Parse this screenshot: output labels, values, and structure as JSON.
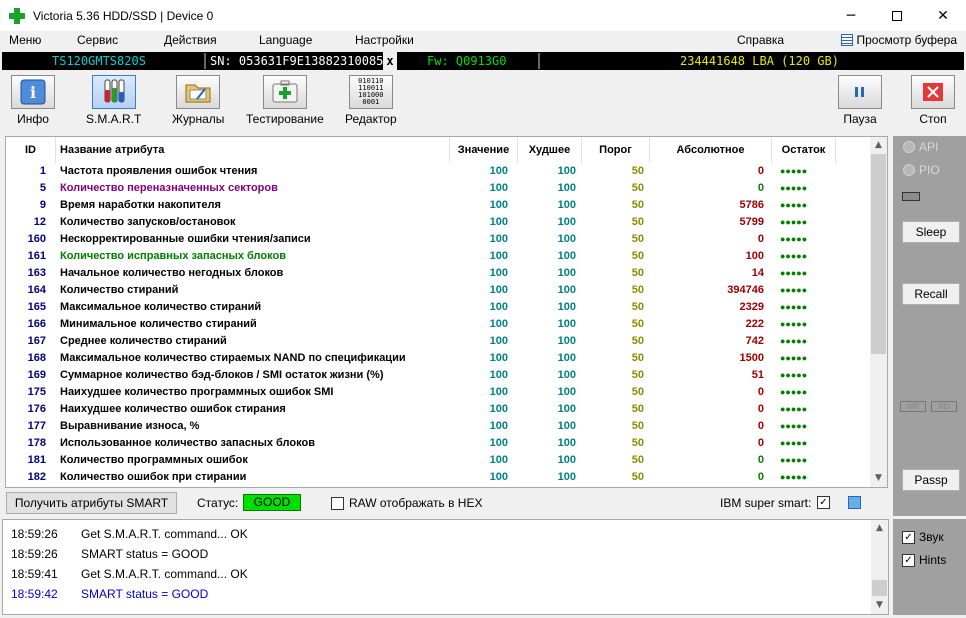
{
  "window": {
    "title": "Victoria 5.36 HDD/SSD | Device 0"
  },
  "menu": {
    "items": [
      "Меню",
      "Сервис",
      "Действия",
      "Language",
      "Настройки"
    ],
    "help": "Справка",
    "buffer": "Просмотр буфера"
  },
  "infobar": {
    "model": "TS120GMTS820S",
    "serial": "SN: 053631F9E13882310085",
    "close": "x",
    "firmware": "Fw: Q0913G0",
    "capacity": "234441648 LBA (120 GB)"
  },
  "toolbar": {
    "info": "Инфо",
    "smart": "S.M.A.R.T",
    "logs": "Журналы",
    "testing": "Тестирование",
    "editor": "Редактор",
    "pause": "Пауза",
    "stop": "Стоп",
    "editor_hex": [
      "010110",
      "110011",
      "101000",
      "0001"
    ]
  },
  "table": {
    "headers": {
      "id": "ID",
      "name": "Название атрибута",
      "value": "Значение",
      "worst": "Худшее",
      "threshold": "Порог",
      "raw": "Абсолютное",
      "remaining": "Остаток"
    },
    "rows": [
      {
        "id": "1",
        "name": "Частота проявления ошибок чтения",
        "value": "100",
        "worst": "100",
        "threshold": "50",
        "raw": "0",
        "remaining": "●●●●●",
        "name_color": "#000000",
        "raw_color": "#a00000"
      },
      {
        "id": "5",
        "name": "Количество переназначенных секторов",
        "value": "100",
        "worst": "100",
        "threshold": "50",
        "raw": "0",
        "remaining": "●●●●●",
        "name_color": "#800080",
        "raw_color": "#008000"
      },
      {
        "id": "9",
        "name": "Время наработки накопителя",
        "value": "100",
        "worst": "100",
        "threshold": "50",
        "raw": "5786",
        "remaining": "●●●●●",
        "name_color": "#000000",
        "raw_color": "#a00000"
      },
      {
        "id": "12",
        "name": "Количество запусков/остановок",
        "value": "100",
        "worst": "100",
        "threshold": "50",
        "raw": "5799",
        "remaining": "●●●●●",
        "name_color": "#000000",
        "raw_color": "#a00000"
      },
      {
        "id": "160",
        "name": "Нескорректированные ошибки чтения/записи",
        "value": "100",
        "worst": "100",
        "threshold": "50",
        "raw": "0",
        "remaining": "●●●●●",
        "name_color": "#000000",
        "raw_color": "#a00000"
      },
      {
        "id": "161",
        "name": "Количество исправных запасных блоков",
        "value": "100",
        "worst": "100",
        "threshold": "50",
        "raw": "100",
        "remaining": "●●●●●",
        "name_color": "#008000",
        "raw_color": "#a00000"
      },
      {
        "id": "163",
        "name": "Начальное количество негодных блоков",
        "value": "100",
        "worst": "100",
        "threshold": "50",
        "raw": "14",
        "remaining": "●●●●●",
        "name_color": "#000000",
        "raw_color": "#a00000"
      },
      {
        "id": "164",
        "name": "Количество стираний",
        "value": "100",
        "worst": "100",
        "threshold": "50",
        "raw": "394746",
        "remaining": "●●●●●",
        "name_color": "#000000",
        "raw_color": "#a00000"
      },
      {
        "id": "165",
        "name": "Максимальное количество стираний",
        "value": "100",
        "worst": "100",
        "threshold": "50",
        "raw": "2329",
        "remaining": "●●●●●",
        "name_color": "#000000",
        "raw_color": "#a00000"
      },
      {
        "id": "166",
        "name": "Минимальное количество стираний",
        "value": "100",
        "worst": "100",
        "threshold": "50",
        "raw": "222",
        "remaining": "●●●●●",
        "name_color": "#000000",
        "raw_color": "#a00000"
      },
      {
        "id": "167",
        "name": "Среднее количество стираний",
        "value": "100",
        "worst": "100",
        "threshold": "50",
        "raw": "742",
        "remaining": "●●●●●",
        "name_color": "#000000",
        "raw_color": "#a00000"
      },
      {
        "id": "168",
        "name": "Максимальное количество стираемых NAND по спецификации",
        "value": "100",
        "worst": "100",
        "threshold": "50",
        "raw": "1500",
        "remaining": "●●●●●",
        "name_color": "#000000",
        "raw_color": "#a00000"
      },
      {
        "id": "169",
        "name": "Суммарное количество бэд-блоков / SMI остаток жизни (%)",
        "value": "100",
        "worst": "100",
        "threshold": "50",
        "raw": "51",
        "remaining": "●●●●●",
        "name_color": "#000000",
        "raw_color": "#a00000"
      },
      {
        "id": "175",
        "name": "Наихудшее количество программных ошибок SMI",
        "value": "100",
        "worst": "100",
        "threshold": "50",
        "raw": "0",
        "remaining": "●●●●●",
        "name_color": "#000000",
        "raw_color": "#a00000"
      },
      {
        "id": "176",
        "name": "Наихудшее количество ошибок стирания",
        "value": "100",
        "worst": "100",
        "threshold": "50",
        "raw": "0",
        "remaining": "●●●●●",
        "name_color": "#000000",
        "raw_color": "#a00000"
      },
      {
        "id": "177",
        "name": "Выравнивание износа, %",
        "value": "100",
        "worst": "100",
        "threshold": "50",
        "raw": "0",
        "remaining": "●●●●●",
        "name_color": "#000000",
        "raw_color": "#a00000"
      },
      {
        "id": "178",
        "name": "Использованное количество запасных блоков",
        "value": "100",
        "worst": "100",
        "threshold": "50",
        "raw": "0",
        "remaining": "●●●●●",
        "name_color": "#000000",
        "raw_color": "#a00000"
      },
      {
        "id": "181",
        "name": "Количество программных ошибок",
        "value": "100",
        "worst": "100",
        "threshold": "50",
        "raw": "0",
        "remaining": "●●●●●",
        "name_color": "#000000",
        "raw_color": "#008000"
      },
      {
        "id": "182",
        "name": "Количество ошибок при стирании",
        "value": "100",
        "worst": "100",
        "threshold": "50",
        "raw": "0",
        "remaining": "●●●●●",
        "name_color": "#000000",
        "raw_color": "#008000"
      }
    ]
  },
  "status_row": {
    "get_attributes": "Получить атрибуты SMART",
    "status_label": "Статус:",
    "status_value": "GOOD",
    "raw_hex": "RAW отображать в HEX",
    "ibm": "IBM super smart:",
    "ibm_check": "✓"
  },
  "log": [
    {
      "time": "18:59:26",
      "text": "Get S.M.A.R.T. command... OK",
      "color": "#000000"
    },
    {
      "time": "18:59:26",
      "text": "SMART status = GOOD",
      "color": "#000000"
    },
    {
      "time": "18:59:41",
      "text": "Get S.M.A.R.T. command... OK",
      "color": "#000000"
    },
    {
      "time": "18:59:42",
      "text": "SMART status = GOOD",
      "color": "#0000cc"
    }
  ],
  "right_panel": {
    "api": "API",
    "pio": "PIO",
    "sleep": "Sleep",
    "recall": "Recall",
    "wr": "WR",
    "rd": "RD",
    "passp": "Passp",
    "sound": "Звук",
    "hints": "Hints",
    "check": "✓"
  },
  "colors": {
    "value": "#008080",
    "threshold": "#8b8b00",
    "remaining": "#008000",
    "model": "#00d0d0",
    "firmware": "#00e000",
    "capacity": "#e8e800",
    "good_bg": "#00e000"
  }
}
